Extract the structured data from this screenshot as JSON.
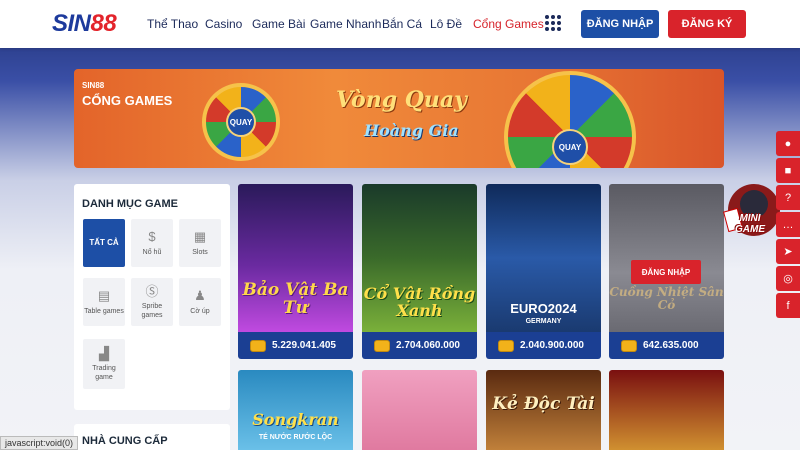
{
  "header": {
    "logo_part1": "SIN",
    "logo_part2": "88",
    "nav": [
      "Thể Thao",
      "Casino",
      "Game Bài",
      "Game Nhanh",
      "Bắn Cá",
      "Lô Đề",
      "Cổng Games"
    ],
    "login_label": "ĐĂNG NHẬP",
    "register_label": "ĐĂNG KÝ",
    "grid_icon": "apps-grid-icon"
  },
  "banner": {
    "brand_small": "SIN88",
    "brand_big": "CỔNG GAMES",
    "title": "Vòng Quay",
    "subtitle": "Hoàng Gia",
    "wheel_hub": "QUAY"
  },
  "sidebar": {
    "title": "DANH MỤC GAME",
    "categories": [
      {
        "label": "TẤT CẢ",
        "icon": "all-icon",
        "active": true
      },
      {
        "label": "Nổ hũ",
        "icon": "money-bag-icon",
        "active": false
      },
      {
        "label": "Slots",
        "icon": "slot-machine-icon",
        "active": false
      },
      {
        "label": "Table games",
        "icon": "cards-icon",
        "active": false
      },
      {
        "label": "Spribe games",
        "icon": "spribe-icon",
        "active": false
      },
      {
        "label": "Cờ úp",
        "icon": "chess-icon",
        "active": false
      },
      {
        "label": "Trading game",
        "icon": "chart-icon",
        "active": false
      }
    ],
    "providers_title": "NHÀ CUNG CẤP"
  },
  "games": [
    {
      "title": "Bảo Vật Ba Tư",
      "jackpot": "5.229.041.405",
      "colors": [
        "#4a2a8a",
        "#b03ad0"
      ]
    },
    {
      "title": "Cổ Vật Rồng Xanh",
      "jackpot": "2.704.060.000",
      "colors": [
        "#2a5a2a",
        "#6ab03a"
      ]
    },
    {
      "title": "EURO2024",
      "subtitle": "GERMANY",
      "jackpot": "2.040.900.000",
      "colors": [
        "#1a3a7a",
        "#3a7ad0"
      ]
    },
    {
      "title": "Cuồng Nhiệt Sân Cỏ",
      "jackpot": "642.635.000",
      "colors": [
        "#6a6a72",
        "#a8a8b0"
      ],
      "overlay": "ĐĂNG NHẬP"
    }
  ],
  "games_row2": [
    {
      "title": "Songkran",
      "subtitle": "TÉ NƯỚC RƯỚC LỘC",
      "colors": [
        "#2a7ab0",
        "#8ad0f0"
      ]
    },
    {
      "title": "",
      "colors": [
        "#e07aa0",
        "#f0b0c8"
      ]
    },
    {
      "title": "Kẻ Độc Tài",
      "colors": [
        "#7a3a1a",
        "#d08a3a"
      ]
    },
    {
      "title": "",
      "colors": [
        "#8a1a1a",
        "#e0a030"
      ]
    }
  ],
  "mini_game": {
    "line1": "MINI",
    "line2": "GAME"
  },
  "right_bar": [
    "user-icon",
    "gift-icon",
    "help-icon",
    "chat-icon",
    "telegram-icon",
    "target-icon",
    "facebook-icon"
  ],
  "status_bar": "javascript:void(0)"
}
